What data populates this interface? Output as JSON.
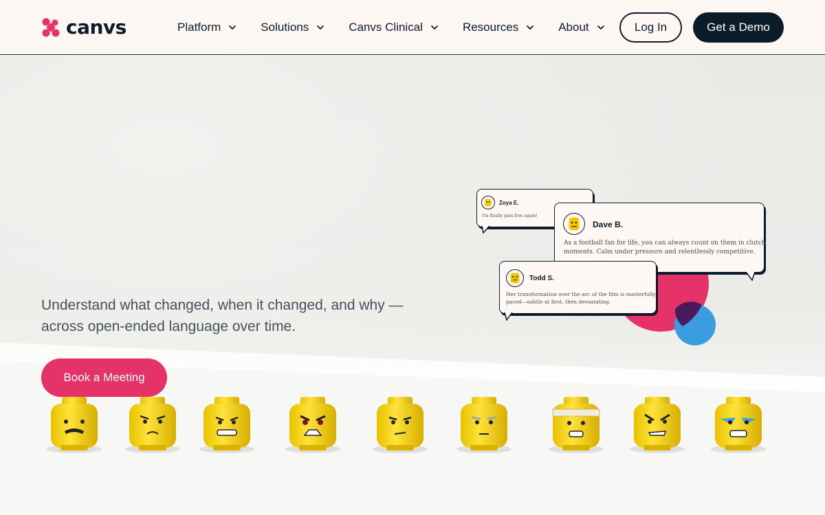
{
  "brand": {
    "name": "canvs",
    "mark_color": "#e53268",
    "text_color": "#0c1b2a"
  },
  "nav": {
    "items": [
      {
        "label": "Platform"
      },
      {
        "label": "Solutions"
      },
      {
        "label": "Canvs Clinical"
      },
      {
        "label": "Resources"
      },
      {
        "label": "About"
      }
    ],
    "login_label": "Log In",
    "demo_label": "Get a Demo"
  },
  "hero": {
    "tagline_line1": "Understand what changed, when it changed, and why —",
    "tagline_line2": "across open-ended language over time.",
    "cta_label": "Book a Meeting",
    "accent_pink": "#e53268",
    "accent_blue": "#3a9de0",
    "accent_purple": "#4b1a5c"
  },
  "quotes": [
    {
      "name": "Zoya E.",
      "text": "I'm finally pain free again!"
    },
    {
      "name": "Dave B.",
      "text_line1": "As a football fan for life, you can always count on them in clutch",
      "text_line2": "moments. Calm under pressure and relentlessly competitive."
    },
    {
      "name": "Todd S.",
      "text_line1": "Her transformation over the arc of the film is masterfully",
      "text_line2": "paced—subtle at first, then devastating."
    }
  ]
}
